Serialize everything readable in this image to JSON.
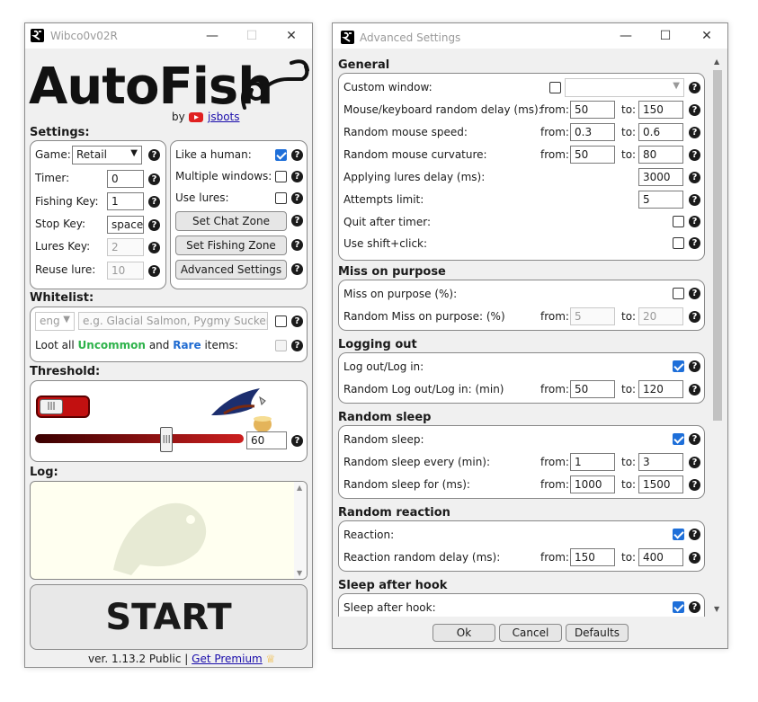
{
  "left_window": {
    "title": "Wibco0v02R",
    "logo_text": "AutoFish",
    "by_prefix": "by",
    "author": "jsbots",
    "settings_header": "Settings:",
    "game_label": "Game:",
    "game_value": "Retail",
    "timer_label": "Timer:",
    "timer_value": "0",
    "fishing_key_label": "Fishing Key:",
    "fishing_key_value": "1",
    "stop_key_label": "Stop Key:",
    "stop_key_value": "space",
    "lures_key_label": "Lures Key:",
    "lures_key_value": "2",
    "reuse_lure_label": "Reuse lure:",
    "reuse_lure_value": "10",
    "like_human_label": "Like a human:",
    "like_human_checked": true,
    "multiple_windows_label": "Multiple windows:",
    "use_lures_label": "Use lures:",
    "set_chat_zone": "Set Chat Zone",
    "set_fishing_zone": "Set Fishing Zone",
    "advanced_settings": "Advanced Settings",
    "whitelist_header": "Whitelist:",
    "whitelist_lang": "eng",
    "whitelist_placeholder": "e.g. Glacial Salmon, Pygmy Suckerfish",
    "loot_all": "Loot all",
    "uncommon": "Uncommon",
    "and": "and",
    "rare": "Rare",
    "items": "items:",
    "threshold_header": "Threshold:",
    "threshold_value": "60",
    "threshold_level": 0.63,
    "log_header": "Log:",
    "start": "START",
    "version": "ver. 1.13.2 Public |",
    "get_premium": "Get Premium",
    "colors": {
      "uncommon": "#2db24a",
      "rare": "#1f6bd1",
      "slider": "#cc1f1f",
      "log_bg": "#fffff0"
    }
  },
  "right_window": {
    "title": "Advanced Settings",
    "general": {
      "header": "General",
      "custom_window": "Custom window:",
      "mk_delay": "Mouse/keyboard random delay (ms):",
      "mk_from": "50",
      "mk_to": "150",
      "mouse_speed": "Random mouse speed:",
      "speed_from": "0.3",
      "speed_to": "0.6",
      "mouse_curv": "Random mouse curvature:",
      "curv_from": "50",
      "curv_to": "80",
      "lures_delay": "Applying lures delay (ms):",
      "lures_delay_value": "3000",
      "attempts": "Attempts limit:",
      "attempts_value": "5",
      "quit_timer": "Quit after timer:",
      "shift_click": "Use shift+click:"
    },
    "miss": {
      "header": "Miss on purpose",
      "miss_pct": "Miss on purpose (%):",
      "random_miss": "Random Miss on purpose: (%)",
      "from": "5",
      "to": "20"
    },
    "logout": {
      "header": "Logging out",
      "logout_login": "Log out/Log in:",
      "random_logout": "Random Log out/Log in: (min)",
      "from": "50",
      "to": "120"
    },
    "sleep": {
      "header": "Random sleep",
      "random_sleep": "Random sleep:",
      "every": "Random sleep every (min):",
      "every_from": "1",
      "every_to": "3",
      "for": "Random sleep for (ms):",
      "for_from": "1000",
      "for_to": "1500"
    },
    "reaction": {
      "header": "Random reaction",
      "reaction": "Reaction:",
      "delay": "Reaction random delay (ms):",
      "from": "150",
      "to": "400"
    },
    "after_hook": {
      "header": "Sleep after hook",
      "label": "Sleep after hook:"
    },
    "from_label": "from:",
    "to_label": "to:",
    "ok": "Ok",
    "cancel": "Cancel",
    "defaults": "Defaults"
  }
}
